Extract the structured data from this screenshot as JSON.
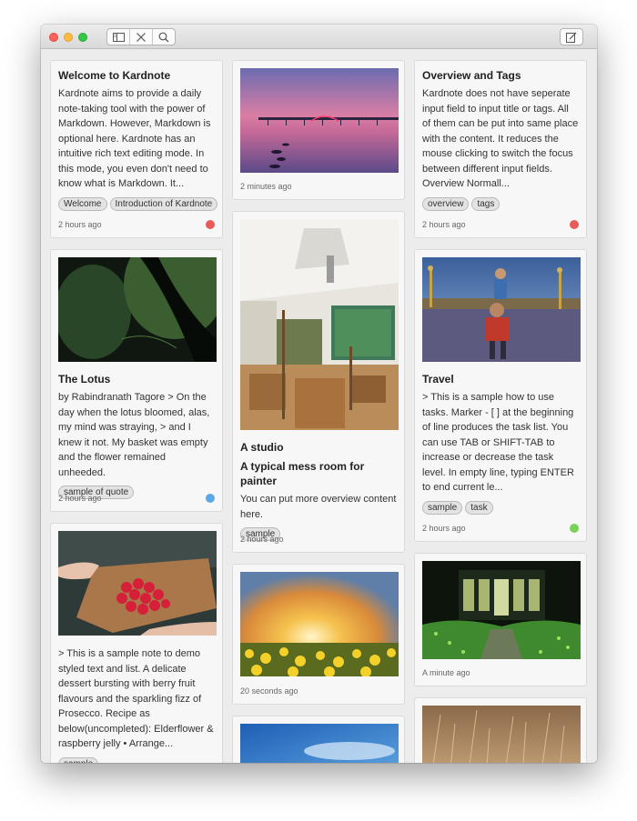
{
  "colors": {
    "red_dot": "#e85b5b",
    "blue_dot": "#5aa9e6",
    "green_dot": "#7bd258"
  },
  "toolbar": {
    "icons": [
      "sidebar-icon",
      "tools-icon",
      "search-icon",
      "compose-icon"
    ]
  },
  "col1": {
    "welcome": {
      "title": "Welcome to Kardnote",
      "body": "Kardnote aims to provide a daily note-taking tool with the power of Markdown. However, Markdown is optional here. Kardnote has an intuitive rich text editing mode. In this mode, you even don't need to know what is Markdown. It...",
      "tags": [
        "Welcome",
        "Introduction of Kardnote"
      ],
      "time": "2 hours ago",
      "dot": "red"
    },
    "lotus": {
      "title": "The Lotus",
      "body": "by Rabindranath Tagore > On the day when the lotus bloomed, alas, my mind was straying, > and I knew it not. My basket was empty and the flower remained unheeded.",
      "tags": [
        "sample of quote"
      ],
      "time": "2 hours ago",
      "dot": "blue"
    },
    "berries": {
      "body": "> This is a sample note to demo styled text and list. A delicate dessert bursting with berry fruit flavours and the sparkling fizz of Prosecco. Recipe as below(uncompleted): Elderflower & raspberry jelly • Arrange...",
      "tags": [
        "sample"
      ]
    }
  },
  "col2": {
    "pier": {
      "time": "2 minutes ago"
    },
    "studio": {
      "title": "A studio",
      "subtitle": "A typical mess room for painter",
      "body": "You can put more overview content here.",
      "tags": [
        "sample"
      ],
      "time": "2 hours ago"
    },
    "sunflower": {
      "time": "20 seconds ago"
    }
  },
  "col3": {
    "overview": {
      "title": "Overview and Tags",
      "body": "Kardnote does not have seperate input field to input title or tags. All of them can be put into same place with the content. It reduces the mouse clicking to switch the focus between different input fields. Overview Normall...",
      "tags": [
        "overview",
        "tags"
      ],
      "time": "2 hours ago",
      "dot": "red"
    },
    "travel": {
      "title": "Travel",
      "body": "> This is a sample how to use tasks. Marker - [ ] at the beginning of line produces the task list. You can use TAB or SHIFT-TAB to increase or decrease the task level. In empty line, typing ENTER to end current le...",
      "tags": [
        "sample",
        "task"
      ],
      "time": "2 hours ago",
      "dot": "green"
    },
    "garden": {
      "time": "A minute ago"
    }
  }
}
